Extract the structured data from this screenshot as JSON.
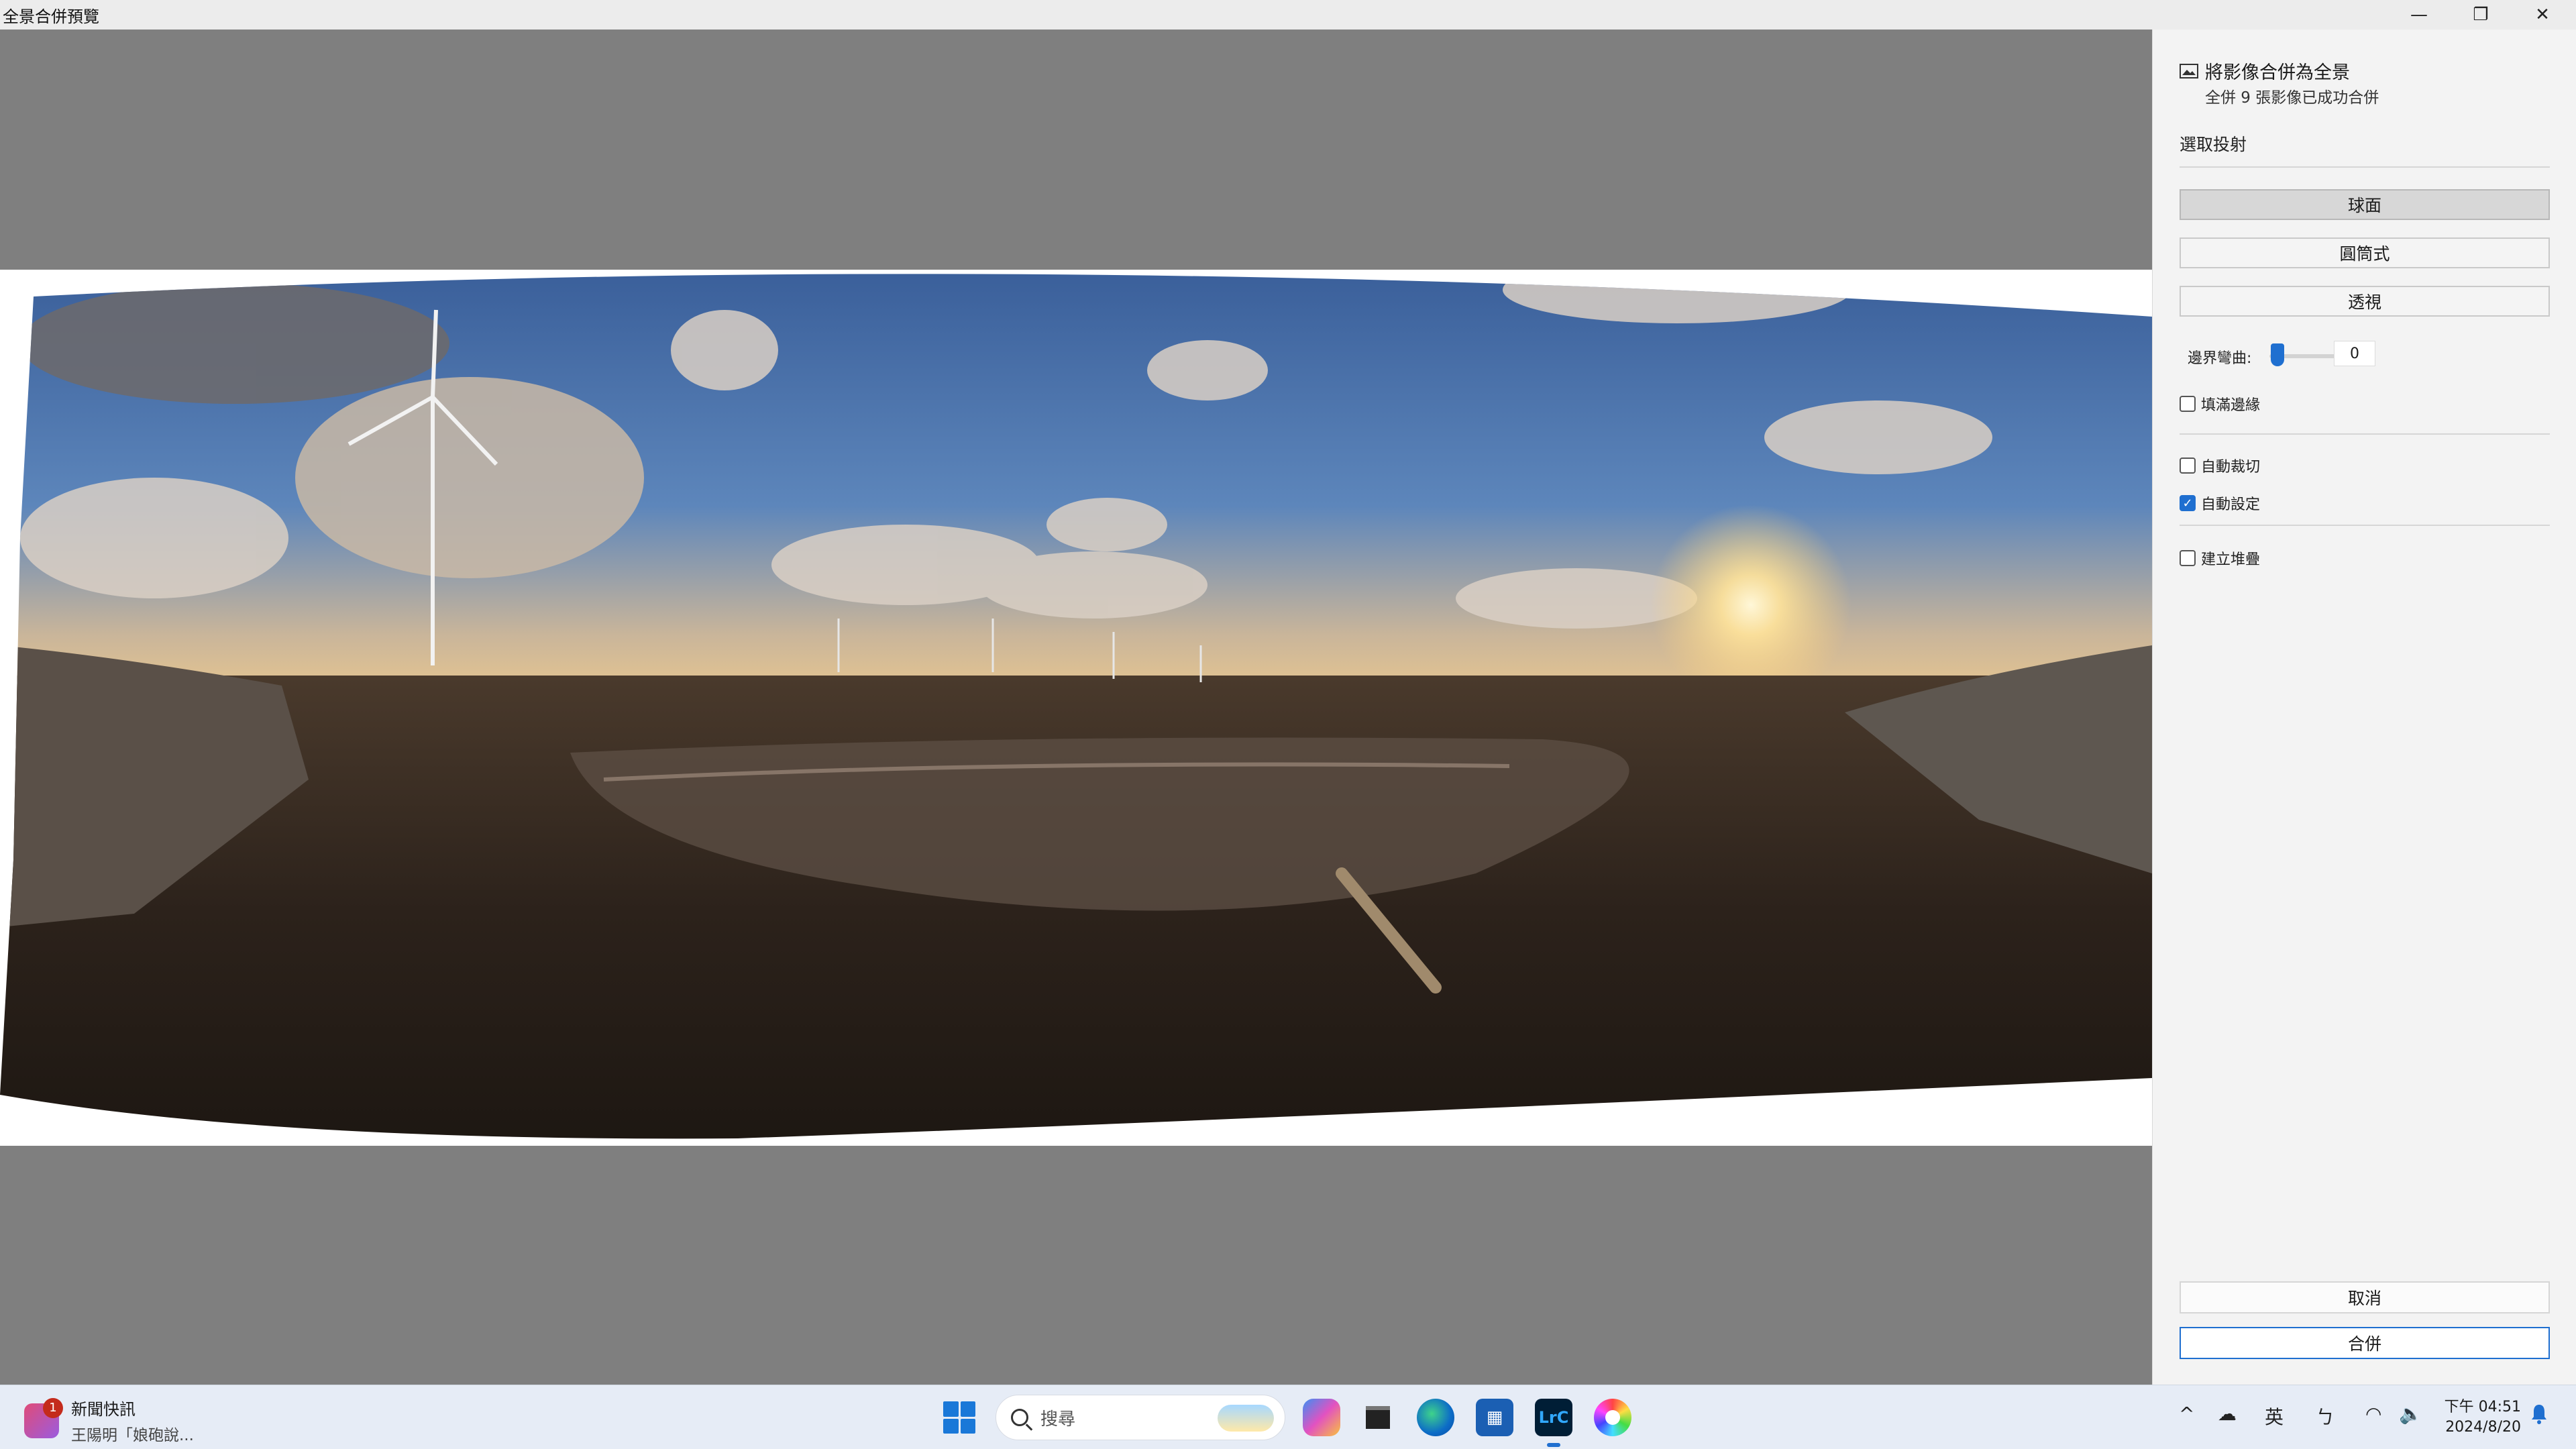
{
  "window": {
    "title": "全景合併預覽",
    "controls": {
      "minimize": "—",
      "maximize": "❐",
      "close": "✕"
    }
  },
  "panel": {
    "title": "將影像合併為全景",
    "subtitle": "全併 9 張影像已成功合併",
    "projection_heading": "選取投射",
    "projections": [
      "球面",
      "圓筒式",
      "透視"
    ],
    "selected_projection": "球面",
    "boundary_warp_label": "邊界彎曲:",
    "boundary_warp_value": "0",
    "boundary_warp_level": 0,
    "fill_edges": "填滿邊緣",
    "fill_edges_checked": false,
    "auto_crop": "自動裁切",
    "auto_crop_checked": false,
    "auto_settings": "自動設定",
    "auto_settings_checked": true,
    "create_stack": "建立堆疊",
    "create_stack_checked": false,
    "cancel": "取消",
    "merge": "合併",
    "accent_color": "#1f6fd0"
  },
  "taskbar": {
    "news_title": "新聞快訊",
    "news_subtitle": "王陽明「娘砲說...",
    "news_badge": "1",
    "search_placeholder": "搜尋",
    "apps": [
      "copilot-icon",
      "file-explorer-icon",
      "edge-icon",
      "store-icon",
      "lightroom-classic-icon",
      "color-wheel-icon"
    ],
    "lrc_label": "LrC",
    "tray": {
      "chevron": "^",
      "lang": "英",
      "ime": "ㄅ"
    },
    "time": "下午 04:51",
    "date": "2024/8/20"
  }
}
